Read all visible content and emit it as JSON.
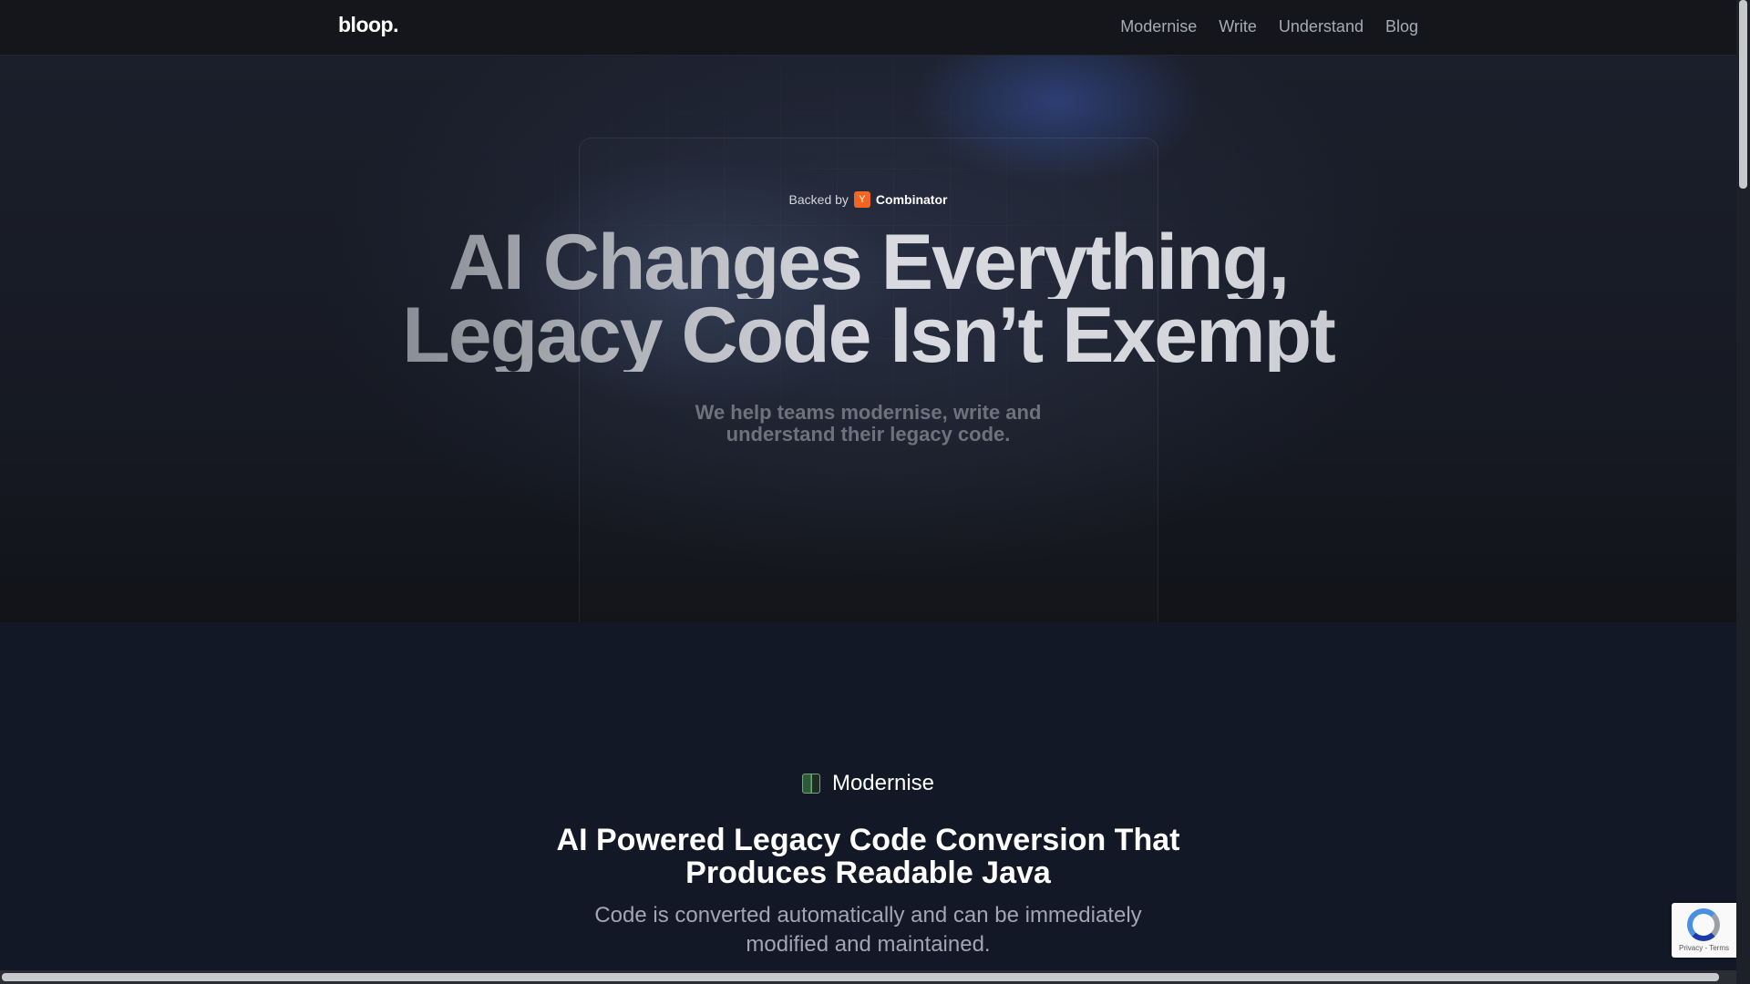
{
  "header": {
    "logo": "bloop.",
    "nav": [
      "Modernise",
      "Write",
      "Understand",
      "Blog"
    ]
  },
  "hero": {
    "backed_label": "Backed by",
    "yc_mark": "Y",
    "yc_name": "Combinator",
    "headline_line1": "AI Changes Everything,",
    "headline_line2": "Legacy Code Isn’t Exempt",
    "subhead_line1": "We help teams modernise, write and",
    "subhead_line2": "understand their legacy code."
  },
  "section": {
    "eyebrow_icon": "code-book-icon",
    "eyebrow": "Modernise",
    "title_line1": "AI Powered Legacy Code Conversion That",
    "title_line2": "Produces Readable Java",
    "desc_line1": "Code is converted automatically and can be immediately",
    "desc_line2": "modified and maintained."
  },
  "recaptcha": {
    "text": "Privacy - Terms"
  },
  "colors": {
    "page_bg": "#131826",
    "header_bg": "#14161c",
    "yc_orange": "#f26522",
    "accent_glow": "#3854aa"
  }
}
